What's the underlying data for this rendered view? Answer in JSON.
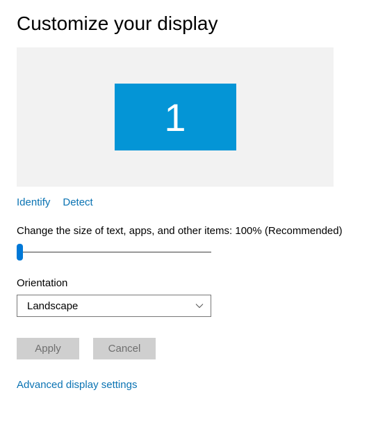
{
  "title": "Customize your display",
  "preview": {
    "monitor_number": "1"
  },
  "links": {
    "identify": "Identify",
    "detect": "Detect"
  },
  "scale": {
    "label_prefix": "Change the size of text, apps, and other items: ",
    "value_text": "100% (Recommended)",
    "percent": 100
  },
  "orientation": {
    "label": "Orientation",
    "selected": "Landscape"
  },
  "buttons": {
    "apply": "Apply",
    "cancel": "Cancel"
  },
  "advanced_link": "Advanced display settings",
  "colors": {
    "accent": "#0078d7",
    "monitor_bg": "#0495d6",
    "link": "#0a73b3",
    "preview_bg": "#f2f2f2",
    "btn_bg": "#cfcfcf",
    "btn_text": "#6e6e6e"
  }
}
